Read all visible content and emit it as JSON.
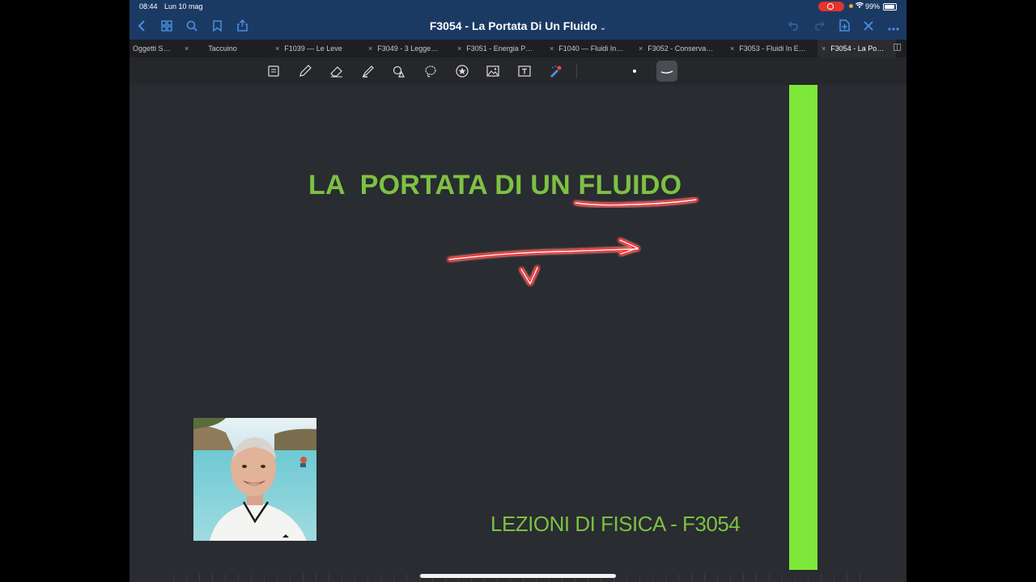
{
  "status": {
    "time": "08:44",
    "date": "Lun 10 mag",
    "battery": "99%"
  },
  "navbar": {
    "title": "F3054 - La Portata Di Un Fluido",
    "title_chevron": "⌄"
  },
  "tabs": [
    {
      "label": "Oggetti S…",
      "active": false
    },
    {
      "label": "Taccuino",
      "active": false
    },
    {
      "label": "F1039 — Le Leve",
      "active": false
    },
    {
      "label": "F3049 - 3 Legge…",
      "active": false
    },
    {
      "label": "F3051 - Energia P…",
      "active": false
    },
    {
      "label": "F1040 — Fluidi In…",
      "active": false
    },
    {
      "label": "F3052 - Conserva…",
      "active": false
    },
    {
      "label": "F3053 - Fluidi In E…",
      "active": false
    },
    {
      "label": "F3054 - La Po…",
      "active": true
    }
  ],
  "tab_close_glyph": "×",
  "slide": {
    "title": "LA  PORTATA DI UN FLUIDO",
    "footer": "LEZIONI DI FISICA - F3054",
    "accent_color": "#7ee83a",
    "text_color": "#7dc142"
  },
  "icons": [
    "back-icon",
    "grid-icon",
    "search-icon",
    "bookmark-icon",
    "share-icon",
    "undo-icon",
    "redo-icon",
    "add-page-icon",
    "close-icon",
    "more-icon"
  ]
}
